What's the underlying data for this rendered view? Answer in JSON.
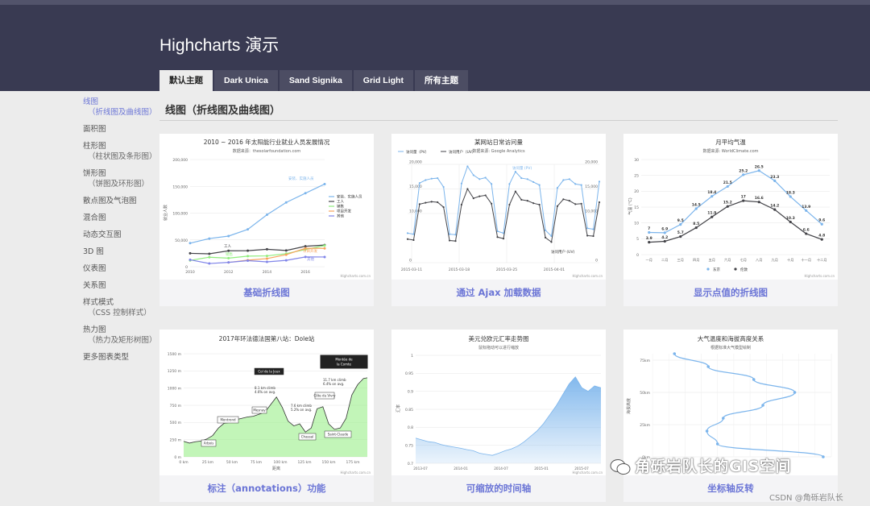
{
  "header": {
    "title": "Highcharts 演示",
    "tabs": [
      {
        "label": "默认主题",
        "active": true
      },
      {
        "label": "Dark Unica",
        "active": false
      },
      {
        "label": "Sand Signika",
        "active": false
      },
      {
        "label": "Grid Light",
        "active": false
      },
      {
        "label": "所有主题",
        "active": false
      }
    ]
  },
  "sidebar": {
    "items": [
      {
        "label": "线图",
        "sub": "（折线图及曲线图）",
        "active": true
      },
      {
        "label": "面积图",
        "sub": "",
        "active": false
      },
      {
        "label": "柱形图",
        "sub": "（柱状图及条形图）",
        "active": false
      },
      {
        "label": "饼形图",
        "sub": "（饼图及环形图）",
        "active": false
      },
      {
        "label": "散点图及气泡图",
        "sub": "",
        "active": false
      },
      {
        "label": "混合图",
        "sub": "",
        "active": false
      },
      {
        "label": "动态交互图",
        "sub": "",
        "active": false
      },
      {
        "label": "3D 图",
        "sub": "",
        "active": false
      },
      {
        "label": "仪表图",
        "sub": "",
        "active": false
      },
      {
        "label": "关系图",
        "sub": "",
        "active": false
      },
      {
        "label": "样式模式",
        "sub": "（CSS 控制样式）",
        "active": false
      },
      {
        "label": "热力图",
        "sub": "（热力及矩形树图）",
        "active": false
      },
      {
        "label": "更多图表类型",
        "sub": "",
        "active": false
      }
    ]
  },
  "main": {
    "section_title": "线图（折线图及曲线图）",
    "captions": [
      "基础折线图",
      "通过 Ajax 加载数据",
      "显示点值的折线图",
      "标注（annotations）功能",
      "可缩放的时间轴",
      "坐标轴反转"
    ]
  },
  "credits": "Highcharts.com.cn",
  "watermark": "角砾岩队长的GIS空间",
  "csdn": "CSDN @角砾岩队长",
  "colors": {
    "accent": "#6b75d6",
    "header": "#393a52",
    "series_blue": "#7cb5ec",
    "series_dark": "#434348",
    "series_green": "#90ed7d",
    "series_orange": "#f7a35c",
    "series_purple": "#8085e9"
  },
  "chart_data": [
    {
      "type": "line",
      "title": "2010 ~ 2016 年太阳能行业就业人员发展情况",
      "subtitle": "数据来源：thesolarfoundation.com",
      "ylabel": "就业人数",
      "x": [
        2010,
        2011,
        2012,
        2013,
        2014,
        2015,
        2016,
        2017
      ],
      "xticks": [
        "2010",
        "2012",
        "2014",
        "2016"
      ],
      "yticks": [
        "0",
        "50,000",
        "100,000",
        "150,000",
        "200,000"
      ],
      "ylim": [
        0,
        200000
      ],
      "legend_position": "right",
      "series": [
        {
          "name": "安装、实施人员",
          "values": [
            43934,
            52503,
            57177,
            69658,
            97031,
            119931,
            137133,
            154175
          ]
        },
        {
          "name": "工人",
          "values": [
            24916,
            24064,
            29742,
            29851,
            32490,
            30282,
            38121,
            40434
          ]
        },
        {
          "name": "销售",
          "values": [
            11744,
            17722,
            16005,
            19771,
            20185,
            24377,
            32147,
            39387
          ]
        },
        {
          "name": "项目开发",
          "values": [
            null,
            null,
            7988,
            12169,
            15112,
            22452,
            34400,
            34227
          ]
        },
        {
          "name": "其他",
          "values": [
            12908,
            5948,
            8105,
            11248,
            8989,
            11816,
            18274,
            18111
          ]
        }
      ],
      "annotations": [
        "安装、实施人员",
        "工人",
        "销售",
        "项目开发",
        "其他"
      ]
    },
    {
      "type": "line",
      "title": "某网站日常访问量",
      "subtitle": "数据来源: Google Analytics",
      "xticks": [
        "2015-03-11",
        "2015-03-18",
        "2015-03-25",
        "2015-04-01"
      ],
      "yticks": [
        "0",
        "10,000",
        "15,000",
        "20,000"
      ],
      "ylim": [
        0,
        20000
      ],
      "legend_position": "top-left",
      "series": [
        {
          "name": "访问量（PV）",
          "values": [
            6000,
            5800,
            16200,
            16800,
            17100,
            17200,
            15400,
            5800,
            5700,
            16100,
            19600,
            17800,
            17000,
            17300,
            16000,
            6400,
            6000,
            16000,
            18500,
            17200,
            17000,
            16400,
            15800,
            6600,
            5400,
            15200,
            16800,
            17000,
            16000,
            15800,
            7000,
            6800,
            16500
          ]
        },
        {
          "name": "访问用户（UV）",
          "values": [
            4800,
            4600,
            11900,
            12200,
            12400,
            12300,
            11300,
            4500,
            4400,
            11800,
            15000,
            13100,
            13500,
            13700,
            12000,
            5200,
            4900,
            11800,
            14500,
            12800,
            12600,
            12100,
            11800,
            5100,
            4200,
            11500,
            12900,
            12600,
            11900,
            12000,
            5500,
            5400,
            12300
          ]
        }
      ],
      "annotations": [
        "访问量 (PV)",
        "访问用户 (UV)"
      ]
    },
    {
      "type": "line",
      "title": "月平均气温",
      "subtitle": "数据来源: WorldClimate.com",
      "ylabel": "气温 (°C)",
      "categories": [
        "一月",
        "二月",
        "三月",
        "四月",
        "五月",
        "六月",
        "七月",
        "八月",
        "九月",
        "十月",
        "十一月",
        "十二月"
      ],
      "yticks": [
        "0",
        "5",
        "10",
        "15",
        "20",
        "25",
        "30"
      ],
      "ylim": [
        0,
        30
      ],
      "legend_position": "bottom",
      "series": [
        {
          "name": "东京",
          "values": [
            7.0,
            6.9,
            9.5,
            14.5,
            18.4,
            21.5,
            25.2,
            26.5,
            23.3,
            18.3,
            13.9,
            9.6
          ]
        },
        {
          "name": "伦敦",
          "values": [
            3.9,
            4.2,
            5.7,
            8.5,
            11.9,
            15.2,
            17.0,
            16.6,
            14.2,
            10.3,
            6.6,
            4.8
          ]
        }
      ]
    },
    {
      "type": "area",
      "title": "2017年环法德法国第八站：Dole站",
      "xlabel": "距离",
      "xticks": [
        "0 km",
        "25 km",
        "50 km",
        "75 km",
        "100 km",
        "125 km",
        "150 km",
        "175 km"
      ],
      "yticks": [
        "0 m",
        "250 m",
        "500 m",
        "750 m",
        "1000 m",
        "1250 m",
        "1500 m"
      ],
      "ylim": [
        0,
        1500
      ],
      "xlim": [
        0,
        190
      ],
      "x": [
        0,
        6,
        12,
        18,
        24,
        30,
        36,
        42,
        48,
        54,
        60,
        66,
        72,
        78,
        84,
        90,
        96,
        102,
        108,
        114,
        120,
        126,
        132,
        138,
        144,
        150,
        156,
        162,
        168,
        174,
        180,
        186,
        190
      ],
      "values": [
        225,
        200,
        220,
        230,
        260,
        310,
        420,
        490,
        500,
        540,
        560,
        580,
        590,
        620,
        650,
        760,
        870,
        720,
        520,
        450,
        480,
        360,
        420,
        700,
        730,
        480,
        400,
        420,
        560,
        900,
        1050,
        1140,
        1150
      ],
      "annotations": [
        "Arbois",
        "Montrond",
        "Mesnay",
        "Col de la Joux",
        "Côte du Vivry",
        "Chassal",
        "Saint-Claude",
        "Montée de la Comte de Lalbia Les Molunes",
        "8.1 km climb 4.6% on avg.",
        "7.6 km climb 5.2% on avg.",
        "11.7 km climb 6.4% on avg."
      ]
    },
    {
      "type": "area",
      "title": "美元兑欧元汇率走势图",
      "subtitle": "鼠标拖动可以进行缩放",
      "ylabel": "汇率",
      "xticks": [
        "2013-07",
        "2014-01",
        "2014-07",
        "2015-01",
        "2015-07"
      ],
      "yticks": [
        "0.7",
        "0.75",
        "0.8",
        "0.85",
        "0.9",
        "0.95",
        "1"
      ],
      "ylim": [
        0.7,
        1.0
      ],
      "values": [
        0.77,
        0.765,
        0.76,
        0.758,
        0.752,
        0.748,
        0.745,
        0.742,
        0.738,
        0.735,
        0.728,
        0.725,
        0.722,
        0.728,
        0.735,
        0.74,
        0.748,
        0.76,
        0.775,
        0.79,
        0.81,
        0.835,
        0.86,
        0.89,
        0.92,
        0.94,
        0.91,
        0.9,
        0.915,
        0.91
      ]
    },
    {
      "type": "line",
      "title": "大气温度和海拔高度关系",
      "subtitle": "根据标准大气模型绘制",
      "ylabel": "海拔高度",
      "yticks": [
        "0km",
        "25km",
        "50km",
        "75km"
      ],
      "ylim": [
        0,
        80
      ],
      "series": [
        {
          "name": "温度",
          "values": [
            [
              0,
              15
            ],
            [
              10,
              -50
            ],
            [
              20,
              -56.5
            ],
            [
              30,
              -46.5
            ],
            [
              40,
              -22.1
            ],
            [
              50,
              -2.5
            ],
            [
              60,
              -27.7
            ],
            [
              70,
              -55.7
            ],
            [
              80,
              -76.5
            ]
          ]
        }
      ],
      "xlim": [
        -90,
        20
      ]
    }
  ]
}
